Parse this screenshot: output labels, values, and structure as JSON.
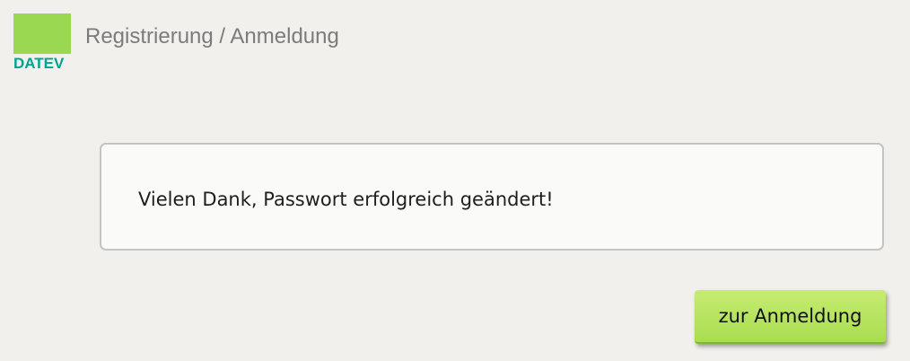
{
  "header": {
    "logo_text": "DATEV",
    "title": "Registrierung / Anmeldung"
  },
  "message": {
    "text": "Vielen Dank, Passwort erfolgreich geändert!"
  },
  "actions": {
    "login_label": "zur Anmeldung"
  },
  "colors": {
    "brand_green": "#9bd851",
    "brand_teal": "#00a38e",
    "button_green": "#b5e35e"
  }
}
